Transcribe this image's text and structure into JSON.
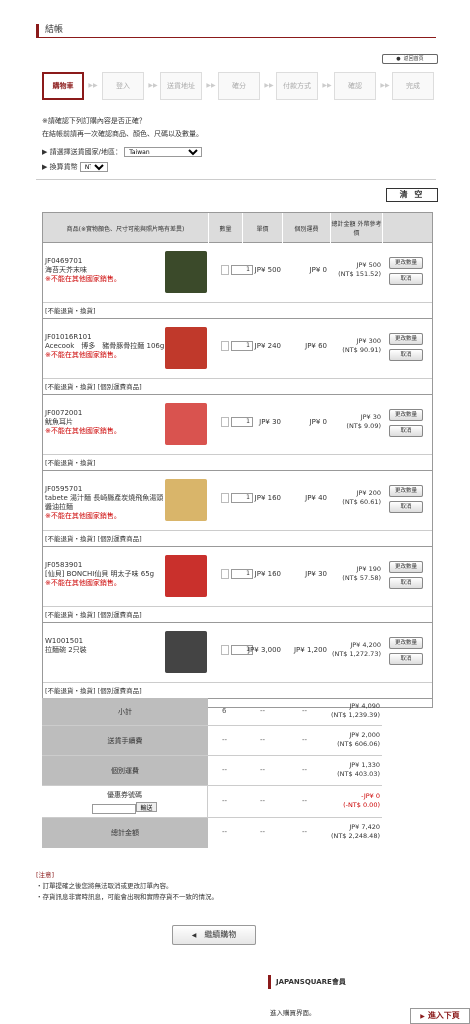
{
  "page": {
    "title": "結帳",
    "back_button": "返回首頁"
  },
  "steps": [
    "購物車",
    "登入",
    "送貨地址",
    "確分",
    "付款方式",
    "確認",
    "完成"
  ],
  "intro": {
    "line1": "※請確認下列訂購內容是否正確？",
    "line2": "在結帳前請再一次確認商品、顏色、尺碼以及數量。",
    "country_label": "請選擇送貨國家/地區：",
    "country_value": "Taiwan",
    "currency_label": "換算貨幣",
    "currency_value": "NT$"
  },
  "clear_button": "清 空",
  "table_headers": {
    "product": "商品(※實物顏色、尺寸可能與照片略有差異)",
    "qty": "數量",
    "unit_price": "單價",
    "shipping": "個別運費",
    "total": "總計金額 外幣參考價"
  },
  "buttons": {
    "change_qty": "更改數量",
    "cancel": "取消"
  },
  "items": [
    {
      "code": "JF0469701",
      "name": "海苔天芥末味",
      "warn": "※不能在其他國家銷售。",
      "qty": "1",
      "unit": "JP¥ 500",
      "ship": "JP¥ 0",
      "total": "JP¥ 500",
      "total_ntd": "(NT$ 151.52)",
      "note": "[不能退貨・換貨]",
      "color": "#3b4a2a"
    },
    {
      "code": "JF01016R101",
      "name": "Acecook　博多　豬骨豚骨拉麵 106g",
      "warn": "※不能在其他國家銷售。",
      "qty": "1",
      "unit": "JP¥ 240",
      "ship": "JP¥ 60",
      "total": "JP¥ 300",
      "total_ntd": "(NT$ 90.91)",
      "note": "[不能退貨・換貨] [個別運費商品]",
      "color": "#c0392b"
    },
    {
      "code": "JF0072001",
      "name": "魷魚耳片",
      "warn": "※不能在其他國家銷售。",
      "qty": "1",
      "unit": "JP¥ 30",
      "ship": "JP¥ 0",
      "total": "JP¥ 30",
      "total_ntd": "(NT$ 9.09)",
      "note": "[不能退貨・換貨]",
      "color": "#d9534f"
    },
    {
      "code": "JF0595701",
      "name": "tabete 湯汁麵 長崎縣產炭燒飛魚湯頭醬油拉麵",
      "warn": "※不能在其他國家銷售。",
      "qty": "1",
      "unit": "JP¥ 160",
      "ship": "JP¥ 40",
      "total": "JP¥ 200",
      "total_ntd": "(NT$ 60.61)",
      "note": "[不能退貨・換貨] [個別運費商品]",
      "color": "#d9b56a"
    },
    {
      "code": "JF0583901",
      "name": "[仙貝] BONCHI仙貝 明太子味 65g",
      "warn": "※不能在其他國家銷售。",
      "qty": "1",
      "unit": "JP¥ 160",
      "ship": "JP¥ 30",
      "total": "JP¥ 190",
      "total_ntd": "(NT$ 57.58)",
      "note": "[不能退貨・換貨] [個別運費商品]",
      "color": "#c9302c"
    },
    {
      "code": "W1001501",
      "name": "拉麵碗 2只裝",
      "warn": "",
      "qty": "1",
      "unit": "JP¥ 3,000",
      "ship": "JP¥ 1,200",
      "total": "JP¥ 4,200",
      "total_ntd": "(NT$ 1,272.73)",
      "note": "[不能退貨・換貨] [個別運費商品]",
      "color": "#444"
    }
  ],
  "summary": {
    "subtotal_label": "小計",
    "subtotal_qty": "6",
    "subtotal": "JP¥ 4,090",
    "subtotal_ntd": "(NT$ 1,239.39)",
    "fee_label": "送貨手續費",
    "fee": "JP¥ 2,000",
    "fee_ntd": "(NT$ 606.06)",
    "ship_label": "個別運費",
    "ship": "JP¥ 1,330",
    "ship_ntd": "(NT$ 403.03)",
    "coupon_label": "優惠券號碼",
    "coupon_button": "輸送",
    "coupon": "-JP¥ 0",
    "coupon_ntd": "(-NT$ 0.00)",
    "total_label": "總計金額",
    "total": "JP¥ 7,420",
    "total_ntd": "(NT$ 2,248.48)",
    "dash": "--"
  },
  "notes": {
    "title": "[注意]",
    "line1": "・訂單提確之後您將無法取消或更改訂單內容。",
    "line2": "・存貨訊息非實時訊息，可能會出現和實際存貨不一致的情況。"
  },
  "continue_button": "繼續購物",
  "member_title": "JAPANSQUARE會員",
  "login_text": "進入購買界面。",
  "next_button": "進入下頁"
}
